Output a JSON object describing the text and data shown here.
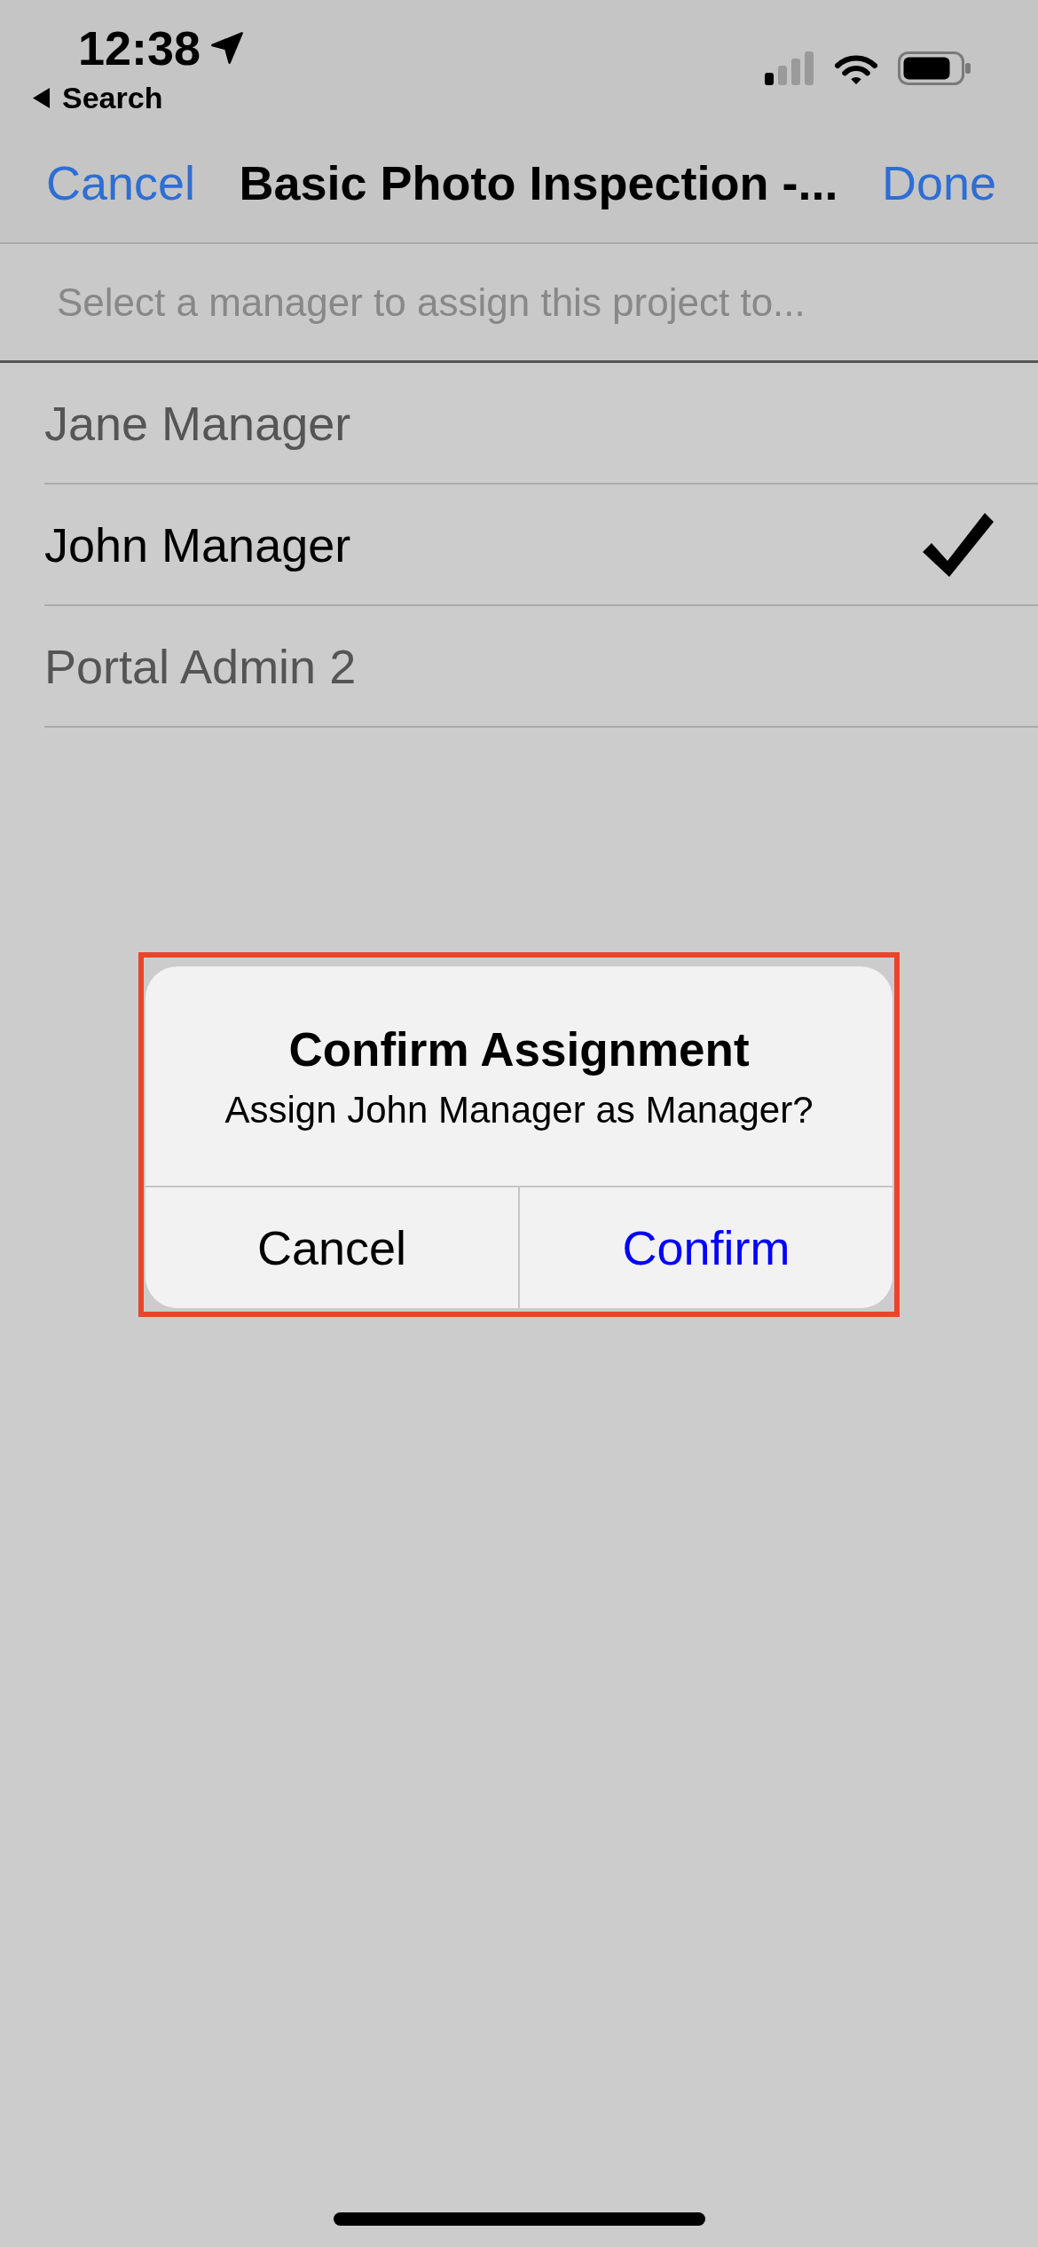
{
  "status_bar": {
    "time": "12:38",
    "back_label": "Search"
  },
  "nav_bar": {
    "left_button": "Cancel",
    "title": "Basic Photo Inspection -...",
    "right_button": "Done"
  },
  "search": {
    "placeholder": "Select a manager to assign this project to..."
  },
  "managers": [
    {
      "name": "Jane Manager",
      "selected": false
    },
    {
      "name": "John Manager",
      "selected": true
    },
    {
      "name": "Portal Admin 2",
      "selected": false
    }
  ],
  "alert": {
    "highlighted": true,
    "title": "Confirm Assignment",
    "message": "Assign John Manager as Manager?",
    "buttons": [
      {
        "label": "Cancel",
        "kind": "cancel"
      },
      {
        "label": "Confirm",
        "kind": "default"
      }
    ]
  }
}
